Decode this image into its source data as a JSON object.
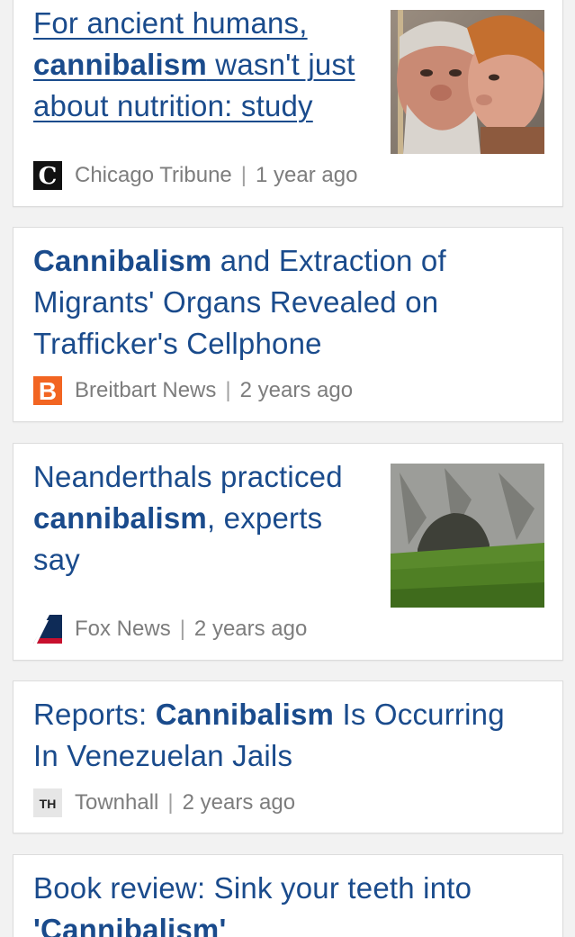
{
  "articles": [
    {
      "title_parts": [
        "For ancient humans, ",
        "cannibalism",
        " wasn't just about nutrition: study"
      ],
      "source": "Chicago Tribune",
      "age": "1 year ago",
      "logo_icon": "chicago-tribune-logo-icon",
      "thumbnail": "neanderthal-reconstructions-image"
    },
    {
      "title_parts": [
        "Cannibalism",
        " and Extraction of Migrants' Organs Revealed on Trafficker's Cellphone"
      ],
      "source": "Breitbart News",
      "age": "2 years ago",
      "logo_icon": "breitbart-logo-icon",
      "logo_text": "B"
    },
    {
      "title_parts": [
        "Neanderthals practiced ",
        "cannibalism",
        ", experts say"
      ],
      "source": "Fox News",
      "age": "2 years ago",
      "logo_icon": "fox-news-logo-icon",
      "thumbnail": "cave-entrance-image"
    },
    {
      "title_parts": [
        "Reports: ",
        "Cannibalism",
        " Is Occurring In Venezuelan Jails"
      ],
      "source": "Townhall",
      "age": "2 years ago",
      "logo_icon": "townhall-logo-icon",
      "logo_text": "TH"
    },
    {
      "title_parts": [
        "Book review: Sink your teeth into ",
        "'Cannibalism'"
      ]
    }
  ],
  "separator": "|",
  "colors": {
    "title": "#1a4b8c",
    "meta": "#7d7d7d",
    "breitbart": "#f26522",
    "fox": "#0e2b57"
  }
}
